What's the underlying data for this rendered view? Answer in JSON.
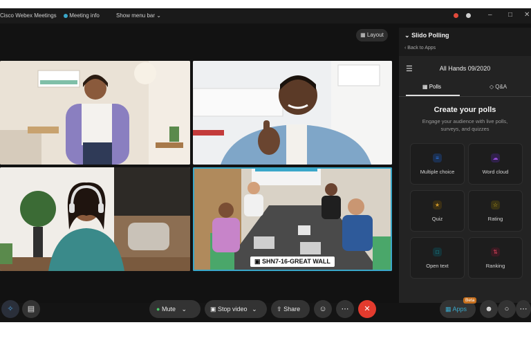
{
  "titlebar": {
    "app_name": "Cisco Webex Meetings",
    "meeting_info": "Meeting info",
    "show_menu_bar": "Show menu bar"
  },
  "main": {
    "layout_button": "Layout",
    "room_label": "SHN7-16-GREAT WALL"
  },
  "panel": {
    "title": "Slido Polling",
    "back": "Back to Apps",
    "event_title": "All Hands 09/2020",
    "tabs": [
      {
        "label": "Polls"
      },
      {
        "label": "Q&A"
      }
    ],
    "create_title": "Create your polls",
    "create_subtitle": "Engage your audience with live polls, surveys, and quizzes",
    "options": [
      {
        "label": "Multiple choice",
        "icon": "list-icon",
        "color": "#2d7cf3"
      },
      {
        "label": "Word cloud",
        "icon": "cloud-icon",
        "color": "#9a4de0"
      },
      {
        "label": "Quiz",
        "icon": "trophy-icon",
        "color": "#d39a2a"
      },
      {
        "label": "Rating",
        "icon": "star-icon",
        "color": "#d4b21f"
      },
      {
        "label": "Open text",
        "icon": "chat-icon",
        "color": "#1fa9b5"
      },
      {
        "label": "Ranking",
        "icon": "ranking-icon",
        "color": "#d9425a"
      }
    ]
  },
  "controls": {
    "mute": "Mute",
    "stop_video": "Stop video",
    "share": "Share",
    "apps": "Apps",
    "beta": "Beta"
  },
  "colors": {
    "end_button": "#e33b2e",
    "active_speaker": "#3aa7c9",
    "apps_accent": "#3aa7c9"
  }
}
